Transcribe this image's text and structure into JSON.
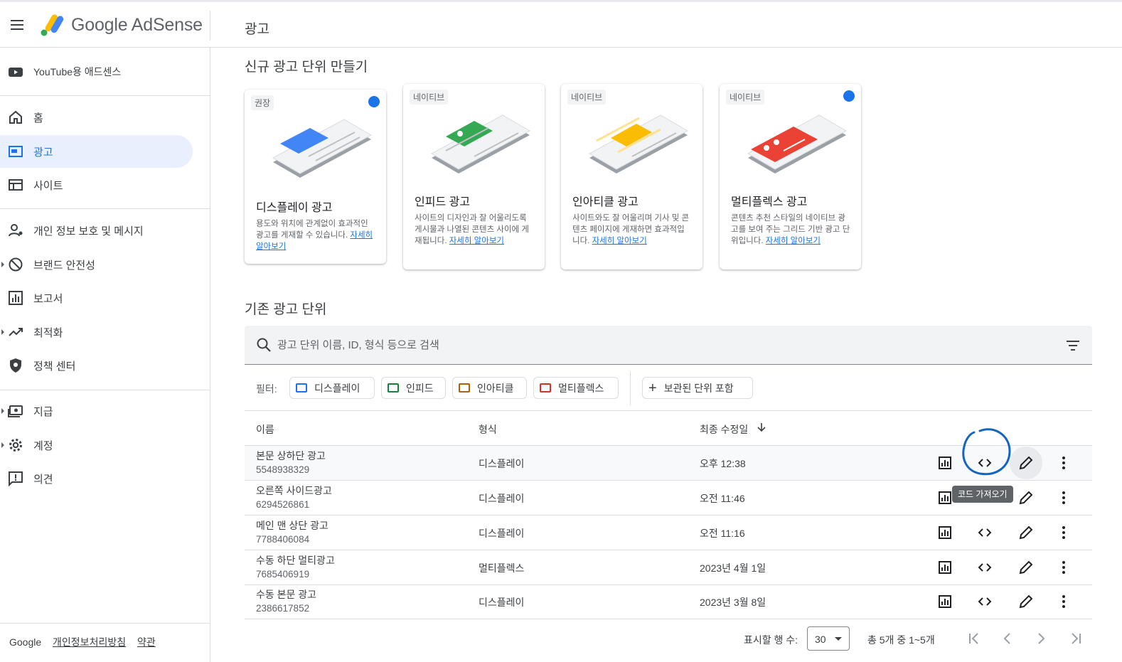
{
  "header": {
    "brand": "Google AdSense",
    "page_title": "광고"
  },
  "sidebar": {
    "youtube_item": "YouTube용 애드센스",
    "items": [
      {
        "label": "홈",
        "icon": "home-icon"
      },
      {
        "label": "광고",
        "icon": "ads-icon"
      },
      {
        "label": "사이트",
        "icon": "sites-icon"
      },
      {
        "label": "개인 정보 보호 및 메시지",
        "icon": "privacy-icon"
      },
      {
        "label": "브랜드 안전성",
        "icon": "block-icon"
      },
      {
        "label": "보고서",
        "icon": "reports-icon"
      },
      {
        "label": "최적화",
        "icon": "trending-icon"
      },
      {
        "label": "정책 센터",
        "icon": "policy-icon"
      },
      {
        "label": "지급",
        "icon": "payments-icon"
      },
      {
        "label": "계정",
        "icon": "settings-icon"
      },
      {
        "label": "의견",
        "icon": "feedback-icon"
      }
    ],
    "footer": {
      "google": "Google",
      "privacy": "개인정보처리방침",
      "terms": "약관"
    }
  },
  "new_units": {
    "title": "신규 광고 단위 만들기",
    "cards": [
      {
        "tag": "권장",
        "title": "디스플레이 광고",
        "desc": "용도와 위치에 관계없이 효과적인 광고를 게재할 수 있습니다.",
        "link": "자세히 알아보기",
        "color": "#4285f4"
      },
      {
        "tag": "네이티브",
        "title": "인피드 광고",
        "desc": "사이트의 디자인과 잘 어울리도록 게시물과 나열된 콘텐츠 사이에 게재됩니다.",
        "link": "자세히 알아보기",
        "color": "#34a853"
      },
      {
        "tag": "네이티브",
        "title": "인아티클 광고",
        "desc": "사이트와도 잘 어울리며 기사 및 콘텐츠 페이지에 게재하면 효과적입니다.",
        "link": "자세히 알아보기",
        "color": "#fbbc04"
      },
      {
        "tag": "네이티브",
        "title": "멀티플렉스 광고",
        "desc": "콘텐츠 추천 스타일의 네이티브 광고를 보여 주는 그리드 기반 광고 단위입니다.",
        "link": "자세히 알아보기",
        "color": "#ea4335"
      }
    ]
  },
  "existing_units": {
    "title": "기존 광고 단위",
    "search_placeholder": "광고 단위 이름, ID, 형식 등으로 검색",
    "filter_label": "필터:",
    "chips": [
      {
        "label": "디스플레이",
        "color": "#1a73e8"
      },
      {
        "label": "인피드",
        "color": "#188038"
      },
      {
        "label": "인아티클",
        "color": "#b06000"
      },
      {
        "label": "멀티플렉스",
        "color": "#d93025"
      }
    ],
    "archived_chip": "보관된 단위 포함",
    "columns": {
      "name": "이름",
      "format": "형식",
      "modified": "최종 수정일"
    },
    "rows": [
      {
        "name": "본문 상하단 광고",
        "id": "5548938329",
        "format": "디스플레이",
        "date": "오후 12:38"
      },
      {
        "name": "오른쪽 사이드광고",
        "id": "6294526861",
        "format": "디스플레이",
        "date": "오전 11:46"
      },
      {
        "name": "메인 맨 상단 광고",
        "id": "7788406084",
        "format": "디스플레이",
        "date": "오전 11:16"
      },
      {
        "name": "수동 하단 멀티광고",
        "id": "7685406919",
        "format": "멀티플렉스",
        "date": "2023년 4월 1일"
      },
      {
        "name": "수동 본문 광고",
        "id": "2386617852",
        "format": "디스플레이",
        "date": "2023년 3월 8일"
      }
    ],
    "tooltip": "코드 가져오기"
  },
  "pagination": {
    "rows_label": "표시할 행 수:",
    "rows_value": "30",
    "range": "총 5개 중 1~5개"
  }
}
